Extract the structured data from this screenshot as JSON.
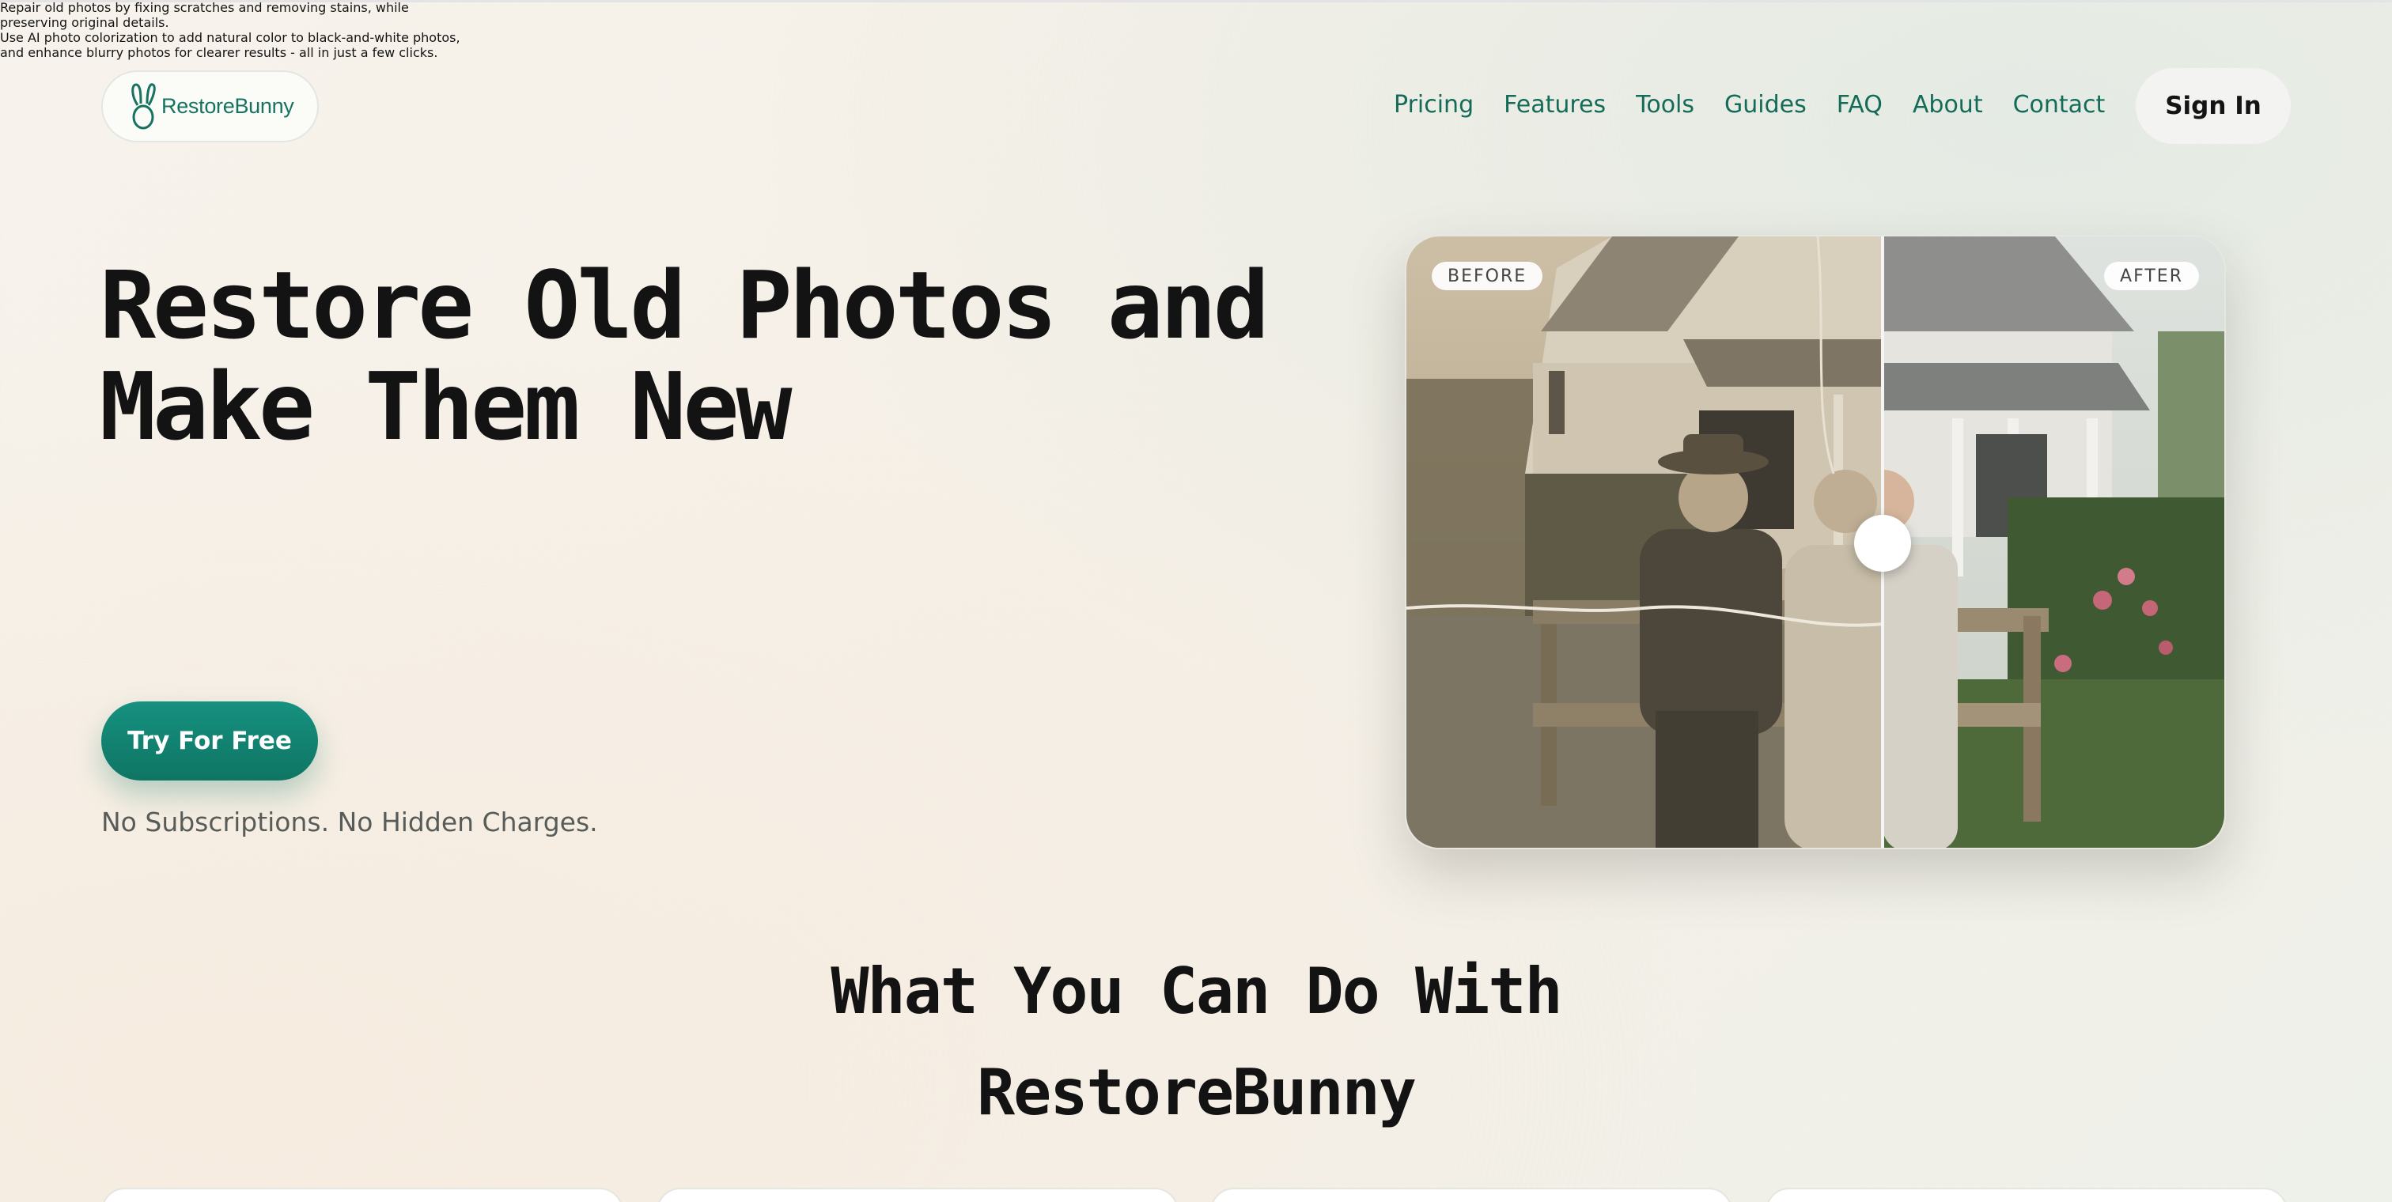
{
  "brand": {
    "name": "RestoreBunny",
    "color": "#16735f"
  },
  "nav": {
    "items": [
      "Pricing",
      "Features",
      "Tools",
      "Guides",
      "FAQ",
      "About",
      "Contact"
    ],
    "sign_in": "Sign In"
  },
  "hero": {
    "title_line1": "Restore Old Photos and",
    "title_line2": "Make Them New",
    "para1_line1": "Repair old photos by fixing scratches and removing stains, while",
    "para1_line2": "preserving original details.",
    "para2_line1": "Use AI photo colorization to add natural color to black-and-white photos,",
    "para2_line2": "and enhance blurry photos for clearer results - all in just a few clicks.",
    "cta": "Try For Free",
    "note": "No Subscriptions. No Hidden Charges.",
    "cta_color": "#128470"
  },
  "viewer": {
    "before_label": "BEFORE",
    "after_label": "AFTER"
  },
  "section": {
    "title_line1": "What You Can Do With",
    "title_line2": "RestoreBunny"
  }
}
